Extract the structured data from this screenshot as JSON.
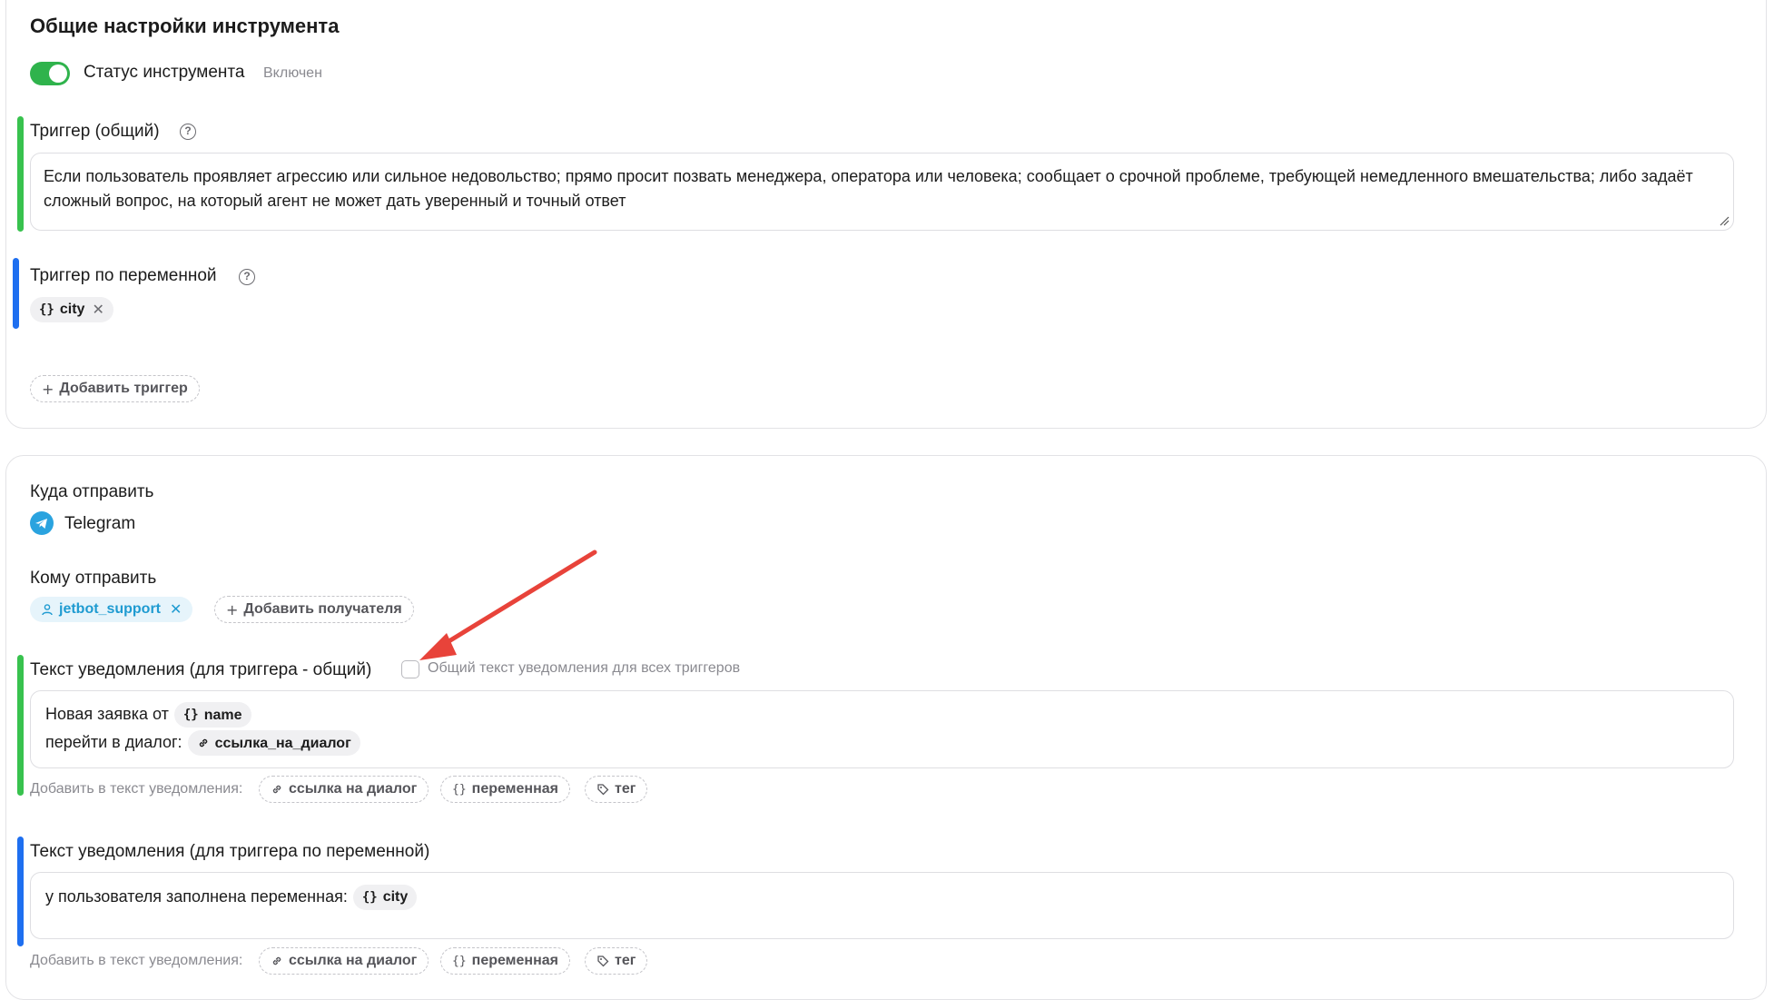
{
  "general": {
    "title": "Общие настройки инструмента",
    "status_label": "Статус инструмента",
    "status_value": "Включен",
    "trigger_general_label": "Триггер (общий)",
    "trigger_general_text": "Если пользователь проявляет агрессию или сильное недовольство; прямо просит позвать менеджера, оператора или человека; сообщает о срочной проблеме, требующей немедленного вмешательства; либо задаёт сложный вопрос, на который агент не может дать уверенный и точный ответ",
    "trigger_var_label": "Триггер по переменной",
    "trigger_var_chip": "city",
    "add_trigger_label": "Добавить триггер"
  },
  "send": {
    "where_label": "Куда отправить",
    "channel": "Telegram",
    "whom_label": "Кому отправить",
    "recipient": "jetbot_support",
    "add_recipient_label": "Добавить получателя",
    "notif_general_label": "Текст уведомления (для триггера - общий)",
    "common_text_checkbox_label": "Общий текст уведомления для всех триггеров",
    "notif_general_line1": "Новая заявка от",
    "notif_general_var1": "name",
    "notif_general_line2": "перейти в диалог:",
    "notif_general_link": "ссылка_на_диалог",
    "add_to_text_label": "Добавить в текст уведомления:",
    "insert_link": "ссылка на диалог",
    "insert_var": "переменная",
    "insert_tag": "тег",
    "notif_var_label": "Текст уведомления (для триггера по переменной)",
    "notif_var_text": "у пользователя заполнена переменная:",
    "notif_var_chip": "city"
  },
  "colors": {
    "toggle_on": "#2fb34c",
    "accent_green": "#38c24e",
    "accent_blue": "#1e6ff0",
    "telegram": "#2aa3df",
    "arrow": "#e8433a"
  }
}
